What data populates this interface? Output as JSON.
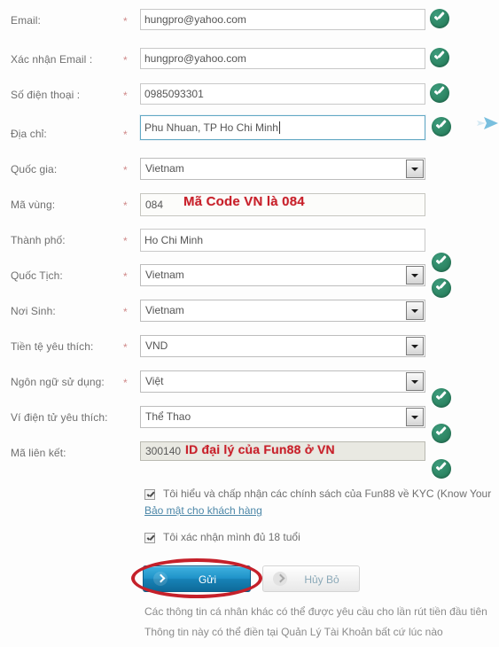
{
  "form": {
    "required_marker": "*",
    "rows": [
      {
        "label": "Email:",
        "required": true,
        "type": "text",
        "value": "hungpro@yahoo.com",
        "name": "email"
      },
      {
        "label": "Xác nhận Email :",
        "required": true,
        "type": "text",
        "value": "hungpro@yahoo.com",
        "name": "confirm-email"
      },
      {
        "label": "Số điện thoại :",
        "required": true,
        "type": "text",
        "value": "0985093301",
        "name": "phone"
      },
      {
        "label": "Địa chỉ:",
        "required": true,
        "type": "text",
        "value": "Phu Nhuan, TP Ho Chi Minh",
        "name": "address"
      },
      {
        "label": "Quốc gia:",
        "required": true,
        "type": "select",
        "value": "Vietnam",
        "name": "country"
      },
      {
        "label": "Mã vùng:",
        "required": true,
        "type": "text",
        "value": "084",
        "name": "area-code"
      },
      {
        "label": "Thành phố:",
        "required": true,
        "type": "text",
        "value": "Ho Chi Minh",
        "name": "city"
      },
      {
        "label": "Quốc Tịch:",
        "required": true,
        "type": "select",
        "value": "Vietnam",
        "name": "nationality"
      },
      {
        "label": "Nơi Sinh:",
        "required": true,
        "type": "select",
        "value": "Vietnam",
        "name": "birthplace"
      },
      {
        "label": "Tiền tệ yêu thích:",
        "required": true,
        "type": "select",
        "value": "VND",
        "name": "currency"
      },
      {
        "label": "Ngôn ngữ sử dụng:",
        "required": true,
        "type": "select",
        "value": "Việt",
        "name": "language"
      },
      {
        "label": "Ví điện tử yêu thích:",
        "required": false,
        "type": "select",
        "value": "Thể Thao",
        "name": "wallet"
      },
      {
        "label": "Mã liên kết:",
        "required": false,
        "type": "text",
        "value": "300140",
        "name": "affiliate-code"
      }
    ]
  },
  "annotations": {
    "area_code_note": "Mã Code VN là 084",
    "affiliate_note": "ID đại lý của Fun88 ở VN",
    "color": "#c8202a"
  },
  "checkboxes": [
    {
      "checked": true,
      "text": "Tôi hiểu và chấp nhận các chính sách của Fun88 về KYC (Know Your",
      "link": "Bảo mật cho khách hàng"
    },
    {
      "checked": true,
      "text": "Tôi xác nhận mình đủ 18 tuổi",
      "link": ""
    }
  ],
  "buttons": {
    "submit": "Gửi",
    "cancel": "Hủy Bỏ"
  },
  "notes": [
    "Các thông tin cá nhân khác có thể được yêu cầu cho lần rút tiền đầu tiên",
    "Thông tin này có thể điền tại Quản Lý Tài Khoản bất cứ lúc nào"
  ],
  "icons": {
    "validation": "green-check-circle",
    "dropdown": "chevron-down-icon",
    "button_chevron": "chevron-right-icon",
    "edge_pointer": "blue-arrow-pointer"
  }
}
